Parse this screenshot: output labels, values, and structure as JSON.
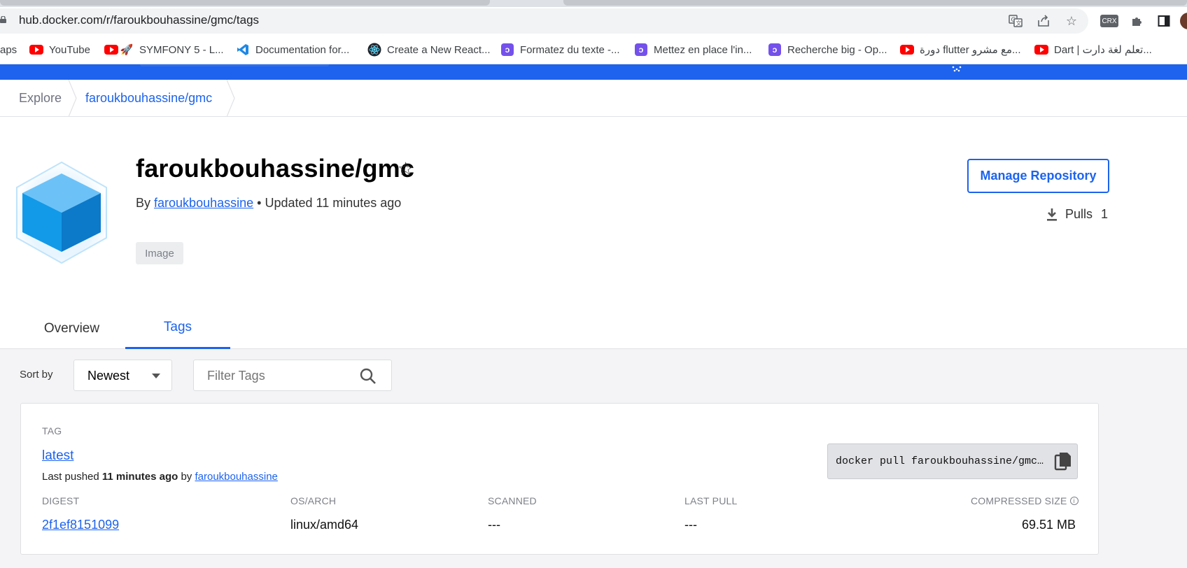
{
  "browser": {
    "url": "hub.docker.com/r/faroukbouhassine/gmc/tags",
    "extension_label": "CRX",
    "bookmarks": [
      {
        "label": "aps",
        "icon": "apps-icon"
      },
      {
        "label": "YouTube",
        "icon": "youtube-icon"
      },
      {
        "label": "SYMFONY 5 - L...",
        "icon": "rocket-icon"
      },
      {
        "label": "Documentation for...",
        "icon": "vscode-icon"
      },
      {
        "label": "Create a New React...",
        "icon": "react-icon"
      },
      {
        "label": "Formatez du texte -...",
        "icon": "openclassrooms-icon"
      },
      {
        "label": "Mettez en place l'in...",
        "icon": "openclassrooms-icon"
      },
      {
        "label": "Recherche big - Op...",
        "icon": "openclassrooms-icon"
      },
      {
        "label": "دورة flutter مع مشرو...",
        "icon": "youtube-icon"
      },
      {
        "label": "Dart | تعلم لغة دارت...",
        "icon": "youtube-icon"
      }
    ]
  },
  "breadcrumb": {
    "explore": "Explore",
    "repo": "faroukbouhassine/gmc"
  },
  "repo": {
    "title": "faroukbouhassine/gmc",
    "by_prefix": "By",
    "owner": "faroukbouhassine",
    "updated": "• Updated 11 minutes ago",
    "badge": "Image",
    "manage_button": "Manage Repository",
    "pulls_label": "Pulls",
    "pulls_count": "1"
  },
  "tabs": [
    {
      "label": "Overview",
      "active": false
    },
    {
      "label": "Tags",
      "active": true
    }
  ],
  "toolbar": {
    "sort_label": "Sort by",
    "sort_value": "Newest",
    "filter_placeholder": "Filter Tags"
  },
  "tag": {
    "header": "TAG",
    "name": "latest",
    "pushed_prefix": "Last pushed",
    "pushed_time": "11 minutes ago",
    "pushed_by": "by",
    "pushed_user": "faroukbouhassine",
    "pull_command": "docker pull faroukbouhassine/gmc:latest",
    "columns": {
      "digest": "DIGEST",
      "os_arch": "OS/ARCH",
      "scanned": "SCANNED",
      "last_pull": "LAST PULL",
      "size": "COMPRESSED SIZE"
    },
    "values": {
      "digest": "2f1ef8151099",
      "os_arch": "linux/amd64",
      "scanned": "---",
      "last_pull": "---",
      "size": "69.51 MB"
    }
  },
  "colors": {
    "brand_blue": "#1d63ed",
    "page_bg": "#f4f4f6"
  }
}
